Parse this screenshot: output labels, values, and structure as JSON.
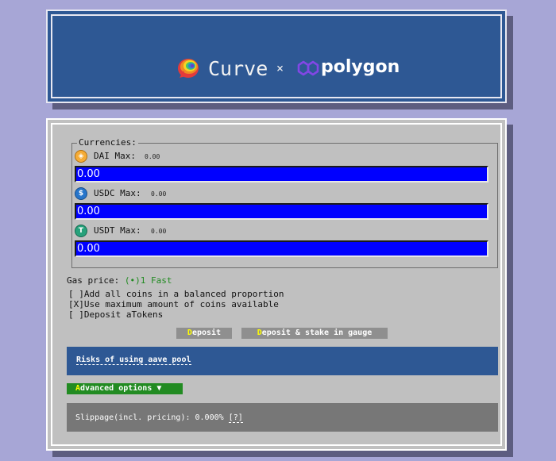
{
  "header": {
    "curve_name": "Curve",
    "separator": "×",
    "partner_name": "polygon"
  },
  "currencies": {
    "legend": "Currencies:",
    "coins": [
      {
        "name": "DAI",
        "max_label": "Max:",
        "max_value": "0.00",
        "amount": "0.00",
        "icon": "dai-icon",
        "color": "#f5ac37"
      },
      {
        "name": "USDC",
        "max_label": "Max:",
        "max_value": "0.00",
        "amount": "0.00",
        "icon": "usdc-icon",
        "color": "#2775ca"
      },
      {
        "name": "USDT",
        "max_label": "Max:",
        "max_value": "0.00",
        "amount": "0.00",
        "icon": "usdt-icon",
        "color": "#26a17b"
      }
    ]
  },
  "gas": {
    "label": "Gas price:",
    "option": "(•)1 Fast"
  },
  "options": [
    {
      "box": "[ ]",
      "text": "Add all coins in a balanced proportion",
      "checked": false
    },
    {
      "box": "[X]",
      "text": "Use maximum amount of coins available",
      "checked": true
    },
    {
      "box": "[ ]",
      "text": "Deposit aTokens",
      "checked": false
    }
  ],
  "buttons": {
    "deposit_hot": "D",
    "deposit_rest": "eposit",
    "deposit_stake_hot": "D",
    "deposit_stake_rest": "eposit & stake in gauge"
  },
  "risks_link": "Risks of using aave pool",
  "advanced": {
    "hot": "A",
    "rest": "dvanced options ▼"
  },
  "slippage": {
    "text": "Slippage(incl. pricing): 0.000%",
    "help": "[?]"
  },
  "colors": {
    "background": "#a7a6d6",
    "header_blue": "#2e5894",
    "panel_gray": "#c0c0c0",
    "input_blue": "#0000ff",
    "button_gray": "#8f8f8f",
    "advanced_green": "#228b22",
    "hotkey_yellow": "#ffff00"
  }
}
